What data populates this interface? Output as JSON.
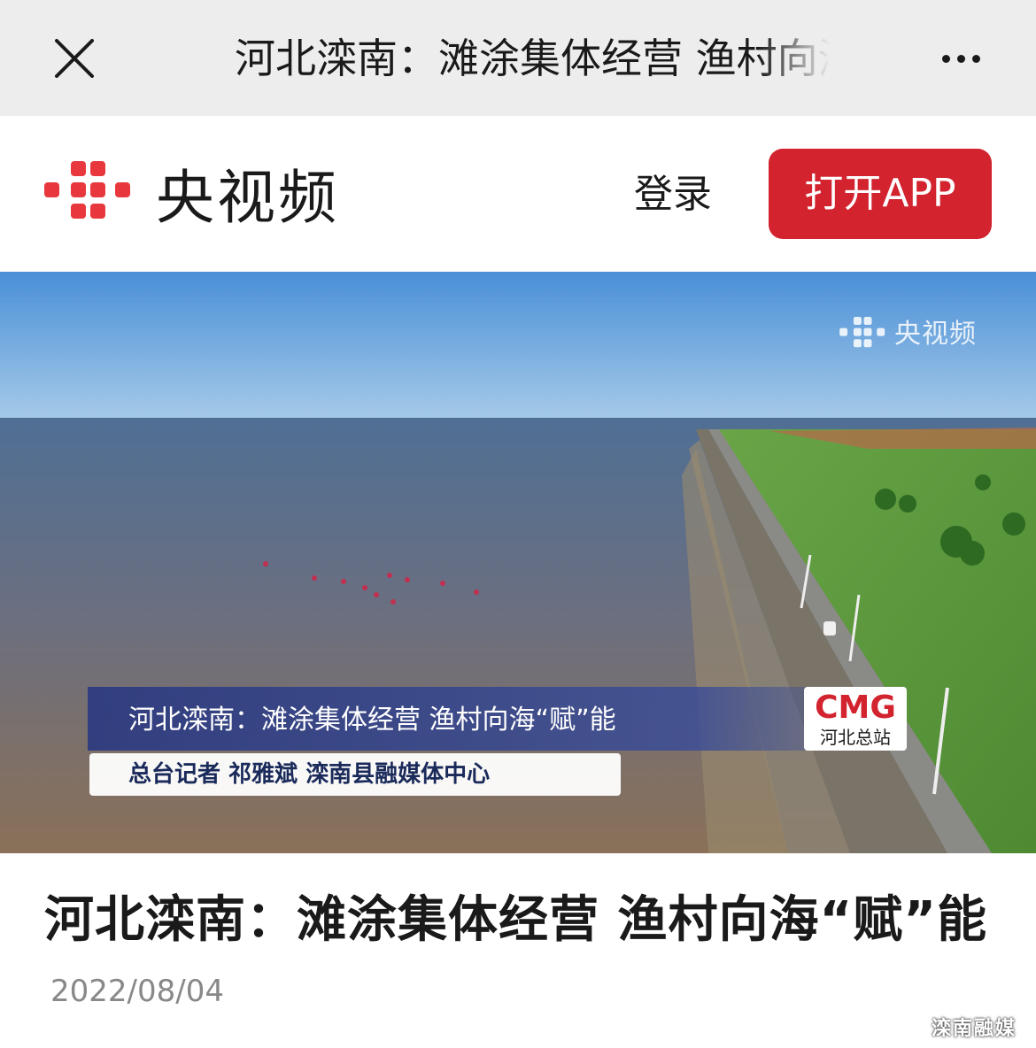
{
  "topbar": {
    "close_icon": "close-icon",
    "title": "河北滦南：滩涂集体经营 渔村向海“赋”能",
    "more_icon": "more-dots-icon"
  },
  "brand": {
    "logo_text": "央视频",
    "login_label": "登录",
    "open_app_label": "打开APP",
    "accent_color": "#d2232f"
  },
  "video": {
    "watermark": "央视频",
    "caption": "河北滦南：滩涂集体经营 渔村向海“赋”能",
    "credit": "总台记者 祁雅斌 滦南县融媒体中心",
    "badge_logo": "CMG",
    "badge_sub": "河北总站"
  },
  "article": {
    "title": "河北滦南：滩涂集体经营 渔村向海“赋”能",
    "date": "2022/08/04"
  },
  "corner_watermark": "滦南融媒"
}
